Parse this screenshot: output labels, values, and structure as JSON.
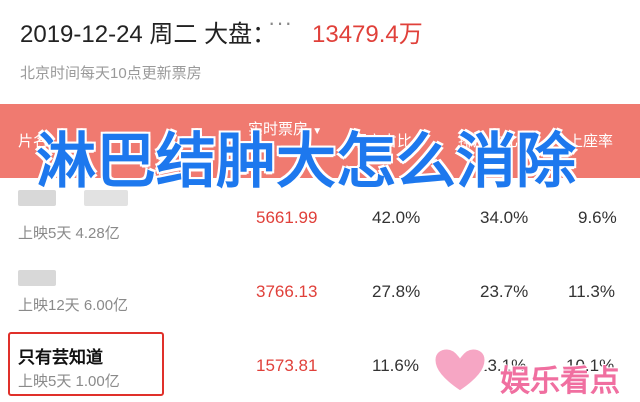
{
  "header": {
    "date": "2019-12-24 周二 大盘：",
    "more_dots": "···",
    "total": "13479.4万",
    "subtitle": "北京时间每天10点更新票房"
  },
  "table": {
    "columns": [
      "片名",
      "实时票房",
      "票房占比",
      "排片占比",
      "上座率"
    ],
    "sort_arrow": "▼",
    "rows": [
      {
        "name": "",
        "release": "上映5天 4.28亿",
        "revenue": "5661.99",
        "share": "42.0%",
        "slot": "34.0%",
        "attendance": "9.6%"
      },
      {
        "name": "",
        "release": "上映12天 6.00亿",
        "revenue": "3766.13",
        "share": "27.8%",
        "slot": "23.7%",
        "attendance": "11.3%"
      },
      {
        "name": "只有芸知道",
        "release": "上映5天 1.00亿",
        "revenue": "1573.81",
        "share": "11.6%",
        "slot": "13.1%",
        "attendance": "10.1%"
      }
    ]
  },
  "overlay": {
    "title": "淋巴结肿大怎么消除"
  },
  "watermark": {
    "text": "娱乐看点"
  },
  "colors": {
    "accent_red": "#e0403a",
    "header_band": "#f07a70",
    "overlay_blue": "#1d78ee",
    "watermark_pink": "#f06fa0"
  }
}
